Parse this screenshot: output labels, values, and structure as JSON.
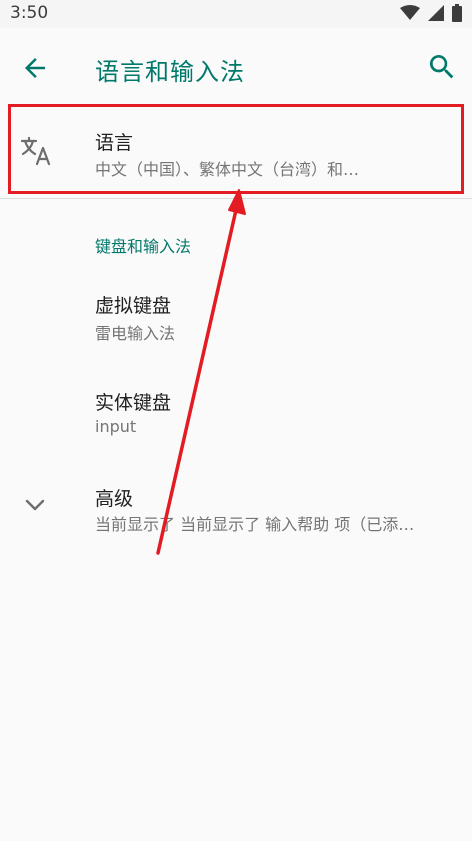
{
  "status_bar": {
    "time": "3:50",
    "icons": [
      "wifi-icon",
      "signal-icon",
      "battery-icon"
    ]
  },
  "app_bar": {
    "title": "语言和输入法",
    "back_icon": "arrow-left-icon",
    "search_icon": "search-icon"
  },
  "language": {
    "title": "语言",
    "subtitle": "中文（中国）、繁体中文（台湾）和…",
    "icon": "translate-icon"
  },
  "keyboard_section": {
    "header": "键盘和输入法",
    "virtual": {
      "title": "虚拟键盘",
      "subtitle": "雷电输入法"
    },
    "physical": {
      "title": "实体键盘",
      "subtitle": "input"
    }
  },
  "advanced": {
    "title": "高级",
    "subtitle": "当前显示了 当前显示了 输入帮助 项（已添…",
    "icon": "chevron-down-icon"
  },
  "colors": {
    "accent": "#00796b",
    "annotation": "#e31b23"
  }
}
